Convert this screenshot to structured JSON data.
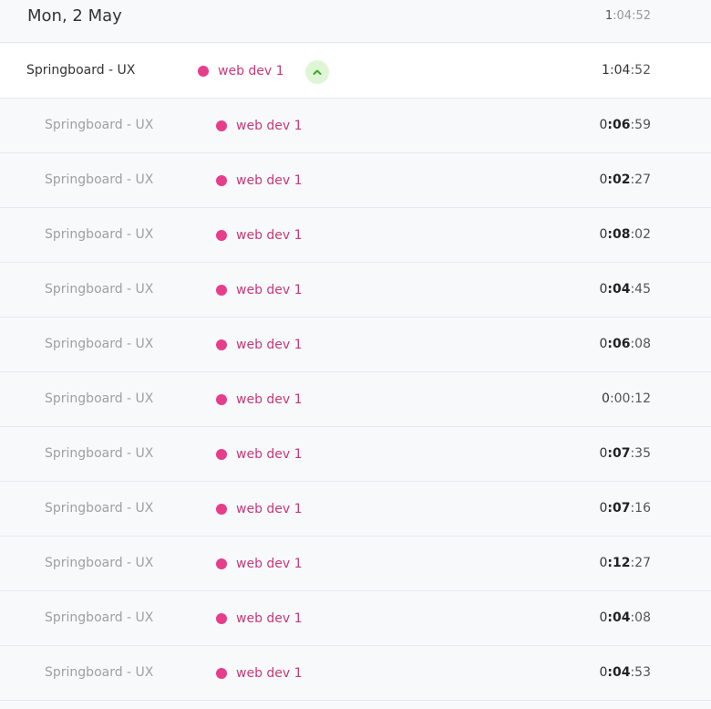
{
  "day": {
    "title": "Mon, 2 May",
    "total": {
      "hours": "1",
      "rest": ":04:52"
    }
  },
  "group": {
    "description": "Springboard - UX",
    "project": "web dev 1",
    "project_color": "#e63e8b",
    "duration": {
      "hours": "1",
      "mins": ":04",
      "secs": ":52"
    },
    "expanded": true,
    "toggle_icon": "chevron-up-icon"
  },
  "entries": [
    {
      "description": "Springboard - UX",
      "project": "web dev 1",
      "duration": {
        "hours": "0",
        "mins": ":06",
        "secs": ":59"
      }
    },
    {
      "description": "Springboard - UX",
      "project": "web dev 1",
      "duration": {
        "hours": "0",
        "mins": ":02",
        "secs": ":27"
      }
    },
    {
      "description": "Springboard - UX",
      "project": "web dev 1",
      "duration": {
        "hours": "0",
        "mins": ":08",
        "secs": ":02"
      }
    },
    {
      "description": "Springboard - UX",
      "project": "web dev 1",
      "duration": {
        "hours": "0",
        "mins": ":04",
        "secs": ":45"
      }
    },
    {
      "description": "Springboard - UX",
      "project": "web dev 1",
      "duration": {
        "hours": "0",
        "mins": ":06",
        "secs": ":08"
      }
    },
    {
      "description": "Springboard - UX",
      "project": "web dev 1",
      "duration": {
        "hours": "0",
        "mins": ":00",
        "secs": ":12"
      }
    },
    {
      "description": "Springboard - UX",
      "project": "web dev 1",
      "duration": {
        "hours": "0",
        "mins": ":07",
        "secs": ":35"
      }
    },
    {
      "description": "Springboard - UX",
      "project": "web dev 1",
      "duration": {
        "hours": "0",
        "mins": ":07",
        "secs": ":16"
      }
    },
    {
      "description": "Springboard - UX",
      "project": "web dev 1",
      "duration": {
        "hours": "0",
        "mins": ":12",
        "secs": ":27"
      }
    },
    {
      "description": "Springboard - UX",
      "project": "web dev 1",
      "duration": {
        "hours": "0",
        "mins": ":04",
        "secs": ":08"
      }
    },
    {
      "description": "Springboard - UX",
      "project": "web dev 1",
      "duration": {
        "hours": "0",
        "mins": ":04",
        "secs": ":53"
      }
    }
  ]
}
